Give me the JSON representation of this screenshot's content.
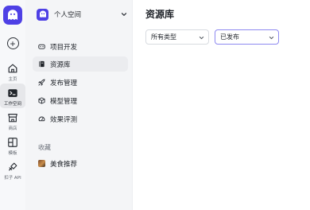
{
  "rail": {
    "items": [
      {
        "label": "主页",
        "icon": "home-icon"
      },
      {
        "label": "工作空间",
        "icon": "terminal-icon",
        "active": true
      },
      {
        "label": "商店",
        "icon": "store-icon"
      },
      {
        "label": "模板",
        "icon": "template-icon"
      },
      {
        "label": "扣子 API",
        "icon": "api-icon"
      }
    ]
  },
  "workspace": {
    "name": "个人空间"
  },
  "nav": {
    "items": [
      {
        "label": "项目开发",
        "icon": "gamepad-icon"
      },
      {
        "label": "资源库",
        "icon": "book-icon",
        "active": true
      },
      {
        "label": "发布管理",
        "icon": "rocket-icon"
      },
      {
        "label": "模型管理",
        "icon": "cube-icon"
      },
      {
        "label": "效果评测",
        "icon": "gauge-icon"
      }
    ]
  },
  "favorites": {
    "heading": "收藏",
    "items": [
      {
        "label": "美食推荐"
      }
    ]
  },
  "main": {
    "title": "资源库",
    "filters": {
      "type": "所有类型",
      "status": "已发布"
    }
  },
  "colors": {
    "brand": "#4e40e5",
    "focus_border": "#8e89f0"
  }
}
